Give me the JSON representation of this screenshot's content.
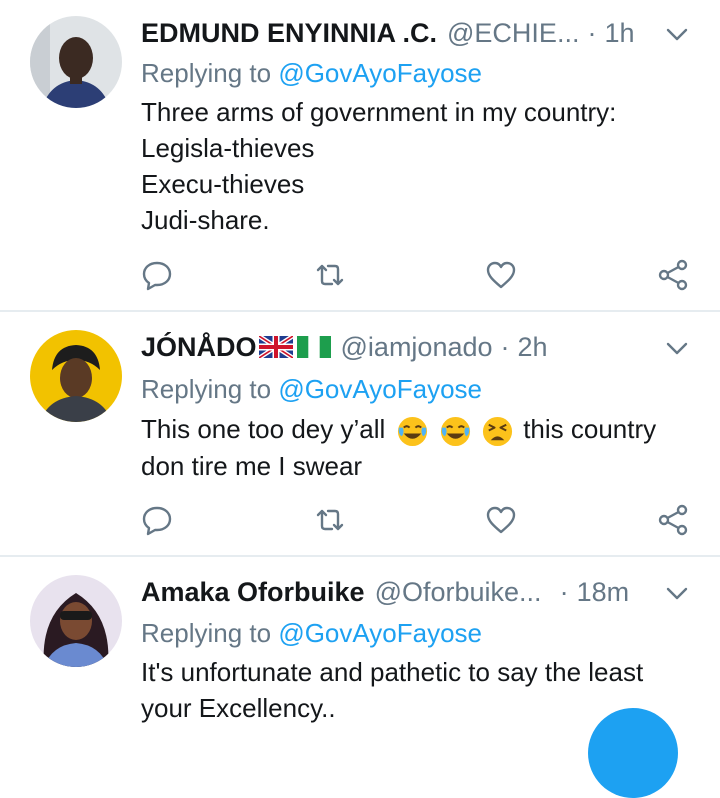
{
  "tweets": [
    {
      "name": "EDMUND ENYINNIA .C.",
      "handle": "@ECHIE...",
      "separator": "·",
      "time": "1h",
      "reply_prefix": "Replying to",
      "reply_to": "@GovAyoFayose",
      "lines": [
        "Three arms of government in my country:",
        "Legisla-thieves",
        "Execu-thieves",
        "Judi-share."
      ]
    },
    {
      "name": "JÓNÅDO",
      "handle": "@iamjonado",
      "separator": "·",
      "time": "2h",
      "reply_prefix": "Replying to",
      "reply_to": "@GovAyoFayose",
      "line1_text": "This one too dey y’all",
      "line1_after": "this country",
      "line2": "don tire me I swear"
    },
    {
      "name": "Amaka Oforbuike",
      "handle": "@Oforbuike...",
      "separator": "·",
      "time": "18m",
      "reply_prefix": "Replying to",
      "reply_to": "@GovAyoFayose",
      "lines": [
        "It's unfortunate and pathetic to say the least",
        "your Excellency.."
      ]
    }
  ],
  "icons": [
    "chevron-down-icon",
    "reply-icon",
    "retweet-icon",
    "like-icon",
    "share-icon",
    "uk-flag-icon",
    "nigeria-flag-icon",
    "joy-emoji-icon",
    "tired-face-emoji-icon"
  ],
  "colors": {
    "accent": "#1da1f2",
    "muted": "#657786",
    "text": "#14171a",
    "divider": "#e6ecf0"
  }
}
